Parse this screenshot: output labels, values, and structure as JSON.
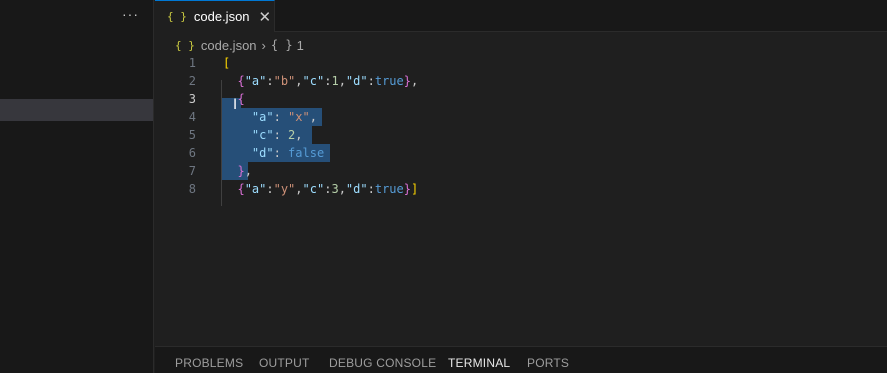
{
  "sidebar": {
    "more_label": "···"
  },
  "tab": {
    "icon": "{ }",
    "label": "code.json",
    "close": "✕"
  },
  "breadcrumb": {
    "file_icon": "{ }",
    "file": "code.json",
    "separator": "›",
    "symbol_icon": "{ }",
    "symbol": "1"
  },
  "editor": {
    "line_numbers": [
      "1",
      "2",
      "3",
      "4",
      "5",
      "6",
      "7",
      "8"
    ],
    "active_line": "3"
  },
  "panel": {
    "tabs": [
      "PROBLEMS",
      "OUTPUT",
      "DEBUG CONSOLE",
      "TERMINAL",
      "PORTS"
    ],
    "active": "TERMINAL"
  },
  "colors": {
    "accent": "#0078d4",
    "selection": "#264f78",
    "background": "#1f1f1f",
    "sidebar_bg": "#181818"
  },
  "icons": {
    "tab_icon": "json-braces-icon",
    "more_icon": "ellipsis-icon",
    "close_icon": "close-icon",
    "cursor": "text-cursor-icon"
  }
}
